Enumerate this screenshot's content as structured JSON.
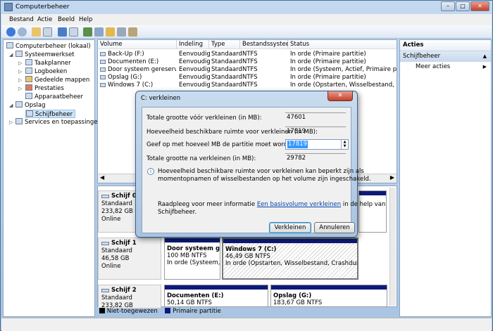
{
  "window": {
    "title": "Computerbeheer",
    "controls": [
      "–",
      "□",
      "✕"
    ]
  },
  "menu": [
    "Bestand",
    "Actie",
    "Beeld",
    "Help"
  ],
  "tree": [
    {
      "label": "Computerbeheer (lokaal)",
      "level": 0
    },
    {
      "label": "Systeemwerkset",
      "level": 1
    },
    {
      "label": "Taakplanner",
      "level": 2
    },
    {
      "label": "Logboeken",
      "level": 2
    },
    {
      "label": "Gedeelde mappen",
      "level": 2
    },
    {
      "label": "Prestaties",
      "level": 2
    },
    {
      "label": "Apparaatbeheer",
      "level": 2
    },
    {
      "label": "Opslag",
      "level": 1
    },
    {
      "label": "Schijfbeheer",
      "level": 2
    },
    {
      "label": "Services en toepassingen",
      "level": 1
    }
  ],
  "volume_table": {
    "headers": [
      "Volume",
      "Indeling",
      "Type",
      "Bestandssysteem",
      "Status"
    ],
    "rows": [
      [
        "Back-Up (F:)",
        "Eenvoudig",
        "Standaard",
        "NTFS",
        "In orde (Primaire partitie)"
      ],
      [
        "Documenten (E:)",
        "Eenvoudig",
        "Standaard",
        "NTFS",
        "In orde (Primaire partitie)"
      ],
      [
        "Door systeem gereserveerd",
        "Eenvoudig",
        "Standaard",
        "NTFS",
        "In orde (Systeem, Actief, Primaire partitie)"
      ],
      [
        "Opslag (G:)",
        "Eenvoudig",
        "Standaard",
        "NTFS",
        "In orde (Primaire partitie)"
      ],
      [
        "Windows 7 (C:)",
        "Eenvoudig",
        "Standaard",
        "NTFS",
        "In orde (Opstarten, Wisselbestand, Crashdu"
      ]
    ]
  },
  "disks": [
    {
      "name": "Schijf 0",
      "type": "Standaard",
      "size": "233,82 GB",
      "state": "Online"
    },
    {
      "name": "Schijf 1",
      "type": "Standaard",
      "size": "46,58 GB",
      "state": "Online"
    },
    {
      "name": "Schijf 2",
      "type": "Standaard",
      "size": "233,82 GB",
      "state": ""
    }
  ],
  "partitions": {
    "disk1_p1": {
      "name": "Door systeem gere",
      "size": "100 MB NTFS",
      "status": "In orde (Systeem, Ac"
    },
    "disk1_p2": {
      "name": "Windows 7  (C:)",
      "size": "46,49 GB NTFS",
      "status": "In orde (Opstarten, Wisselbestand, Crashdump, Prin"
    },
    "disk2_p1": {
      "name": "Documenten  (E:)",
      "size": "50,14 GB NTFS"
    },
    "disk2_p2": {
      "name": "Opslag  (G:)",
      "size": "183,67 GB NTFS"
    }
  },
  "legend": [
    "Niet-toegewezen",
    "Primaire partitie"
  ],
  "actions": {
    "title": "Acties",
    "section": "Schijfbeheer",
    "more": "Meer acties"
  },
  "dialog": {
    "title": "C: verkleinen",
    "total_before_label": "Totale grootte vóór verkleinen (in MB):",
    "total_before": "47601",
    "available_label": "Hoeveelheid beschikbare ruimte voor verkleinen (in MB):",
    "available": "17819",
    "shrink_label": "Geef op met hoeveel MB de partitie moet worden verkleind:",
    "shrink_value": "17819",
    "total_after_label": "Totale grootte na verkleinen (in MB):",
    "total_after": "29782",
    "info_line1": "Hoeveelheid beschikbare ruimte voor verkleinen kan beperkt zijn als",
    "info_line2": "momentopnamen of wisselbestanden op het volume zijn ingeschakeld.",
    "help_prefix": "Raadpleeg voor meer informatie ",
    "help_link": "Een basisvolume verkleinen",
    "help_suffix": " in de help van",
    "help_line2": "Schijfbeheer.",
    "ok": "Verkleinen",
    "cancel": "Annuleren"
  },
  "colors": {
    "primary_partition": "#0d1a7a",
    "unallocated": "#000000"
  }
}
